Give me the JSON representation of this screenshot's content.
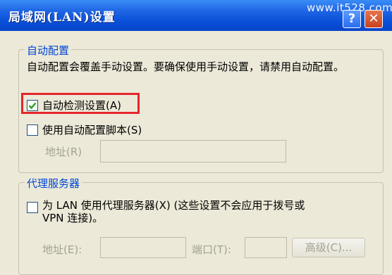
{
  "window": {
    "title": "局域网(LAN)设置",
    "watermark": "www.it528.com",
    "help_glyph": "?",
    "close_glyph": "✕"
  },
  "auto_config": {
    "legend": "自动配置",
    "description": "自动配置会覆盖手动设置。要确保使用手动设置，请禁用自动配置。",
    "auto_detect": {
      "label": "自动检测设置(A)",
      "checked": true
    },
    "use_script": {
      "label": "使用自动配置脚本(S)",
      "checked": false
    },
    "address_label": "地址(R)",
    "address_value": ""
  },
  "proxy": {
    "legend": "代理服务器",
    "use_proxy_label_line1": "为 LAN 使用代理服务器(X) (这些设置不会应用于拨号或",
    "use_proxy_label_line2": "VPN 连接)。",
    "use_proxy_checked": false,
    "address_label": "地址(E):",
    "address_value": "",
    "port_label": "端口(T):",
    "port_value": "",
    "advanced_button": "高级(C)..."
  },
  "colors": {
    "titlebar": "#0a4fd8",
    "dialog_bg": "#ece9d8",
    "legend_text": "#0046d5",
    "highlight_border": "#e4262b",
    "disabled_text": "#a3a293"
  }
}
